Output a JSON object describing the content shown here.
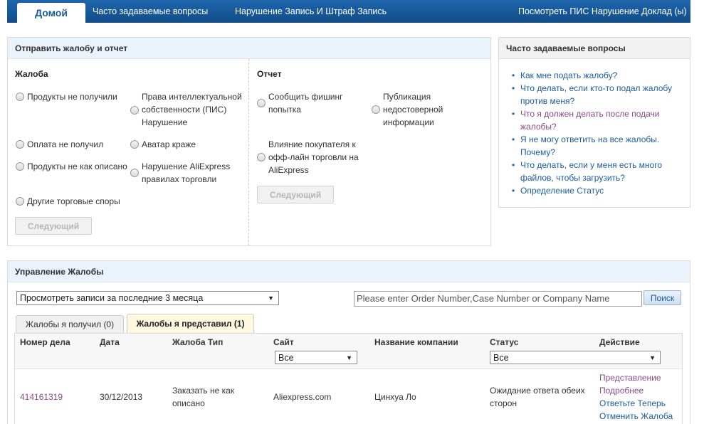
{
  "nav": {
    "home": "Домой",
    "faq": "Часто задаваемые вопросы",
    "violations": "Нарушение Запись И Штраф Запись",
    "view_report": "Посмотреть ПИС Нарушение Доклад (ы)"
  },
  "submit_panel": {
    "title": "Отправить жалобу и отчет",
    "complaint": {
      "title": "Жалоба",
      "options": [
        "Продукты не получили",
        "Права интеллектуальной собственности (ПИС) Нарушение",
        "Оплата не получил",
        "Аватар краже",
        "Продукты не как описано",
        "Нарушение AliExpress правилах торговли",
        "Другие торговые споры"
      ],
      "next_button": "Следующий"
    },
    "report": {
      "title": "Отчет",
      "options": [
        "Сообщить фишинг попытка",
        "Публикация недостоверной информации",
        "Влияние покупателя к офф-лайн торговли на AliExpress"
      ],
      "next_button": "Следующий"
    }
  },
  "faq_panel": {
    "title": "Часто задаваемые вопросы",
    "items": [
      "Как мне подать жалобу?",
      "Что делать, если кто-то подал жалобу против меня?",
      "Что я должен делать после подачи жалобы?",
      "Я не могу ответить на все жалобы. Почему?",
      "Что делать, если у меня есть много файлов, чтобы загрузить?",
      "Определение Статус"
    ]
  },
  "manage_panel": {
    "title": "Управление Жалобы",
    "period_select": "Просмотреть записи за последние 3 месяца",
    "search_placeholder": "Please enter Order Number,Case Number or Company Name",
    "search_button": "Поиск",
    "tabs": {
      "received": "Жалобы я получил (0)",
      "submitted": "Жалобы я представил (1)"
    },
    "columns": {
      "case_number": "Номер дела",
      "date": "Дата",
      "type": "Жалоба Тип",
      "site": "Сайт",
      "company": "Название компании",
      "status": "Статус",
      "action": "Действие"
    },
    "site_filter": "Все",
    "status_filter": "Все",
    "rows": [
      {
        "case_number": "414161319",
        "date": "30/12/2013",
        "type": "Заказать не как описано",
        "site": "Aliexpress.com",
        "company": "Цинхуа Ло",
        "status": "Ожидание ответа обеих сторон",
        "actions": [
          "Представление",
          "Подробнее",
          "Ответьте Теперь",
          "Отменить Жалоба"
        ]
      }
    ]
  }
}
